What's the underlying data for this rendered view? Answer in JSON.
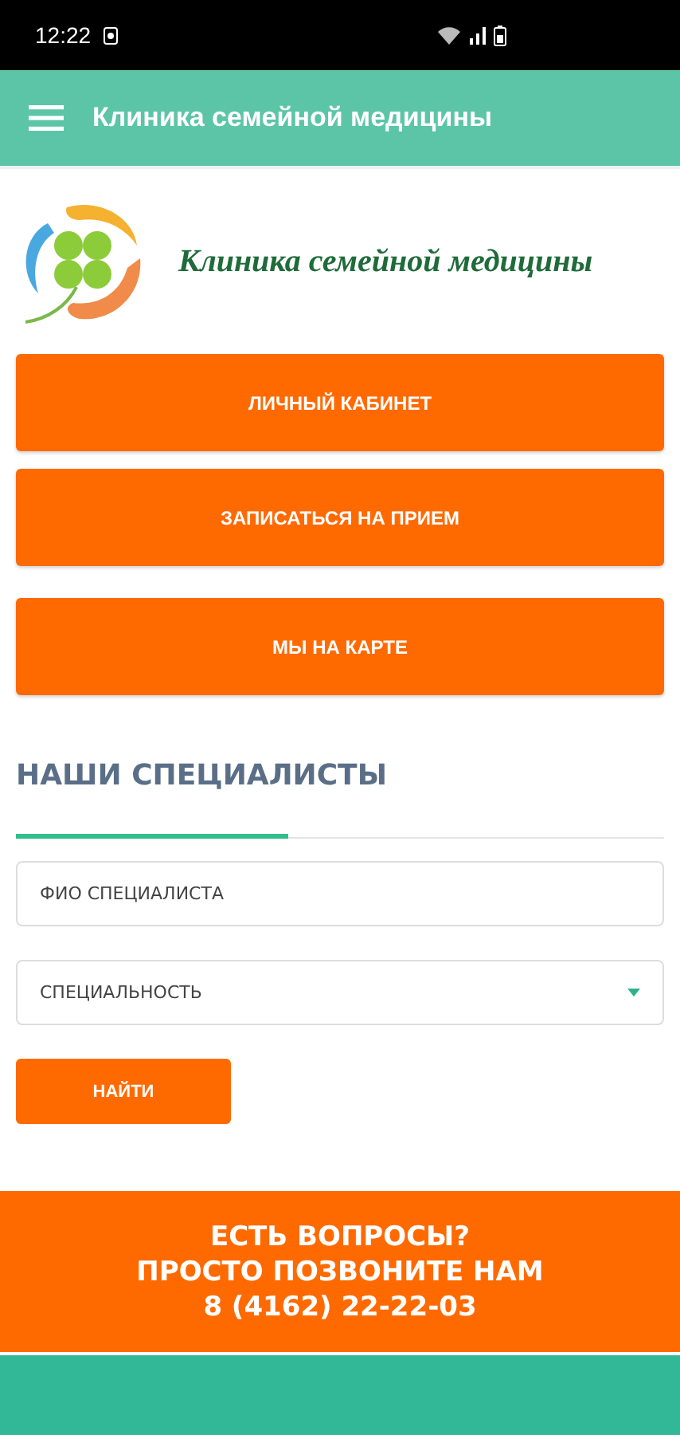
{
  "status_bar": {
    "time": "12:22"
  },
  "app_bar": {
    "title": "Клиника семейной медицины"
  },
  "logo": {
    "text": "Клиника семейной медицины"
  },
  "buttons": [
    "ЛИЧНЫЙ КАБИНЕТ",
    "ЗАПИСАТЬСЯ НА ПРИЕМ",
    "МЫ НА КАРТЕ"
  ],
  "specialists": {
    "title": "НАШИ СПЕЦИАЛИСТЫ",
    "name_field": {
      "placeholder": "ФИО СПЕЦИАЛИСТА"
    },
    "specialty_select": {
      "placeholder": "СПЕЦИАЛЬНОСТЬ"
    },
    "search_button": "НАЙТИ"
  },
  "contact_banner": {
    "lines": [
      "ЕСТЬ ВОПРОСЫ?",
      "ПРОСТО ПОЗВОНИТЕ НАМ",
      "8 (4162) 22-22-03"
    ]
  }
}
